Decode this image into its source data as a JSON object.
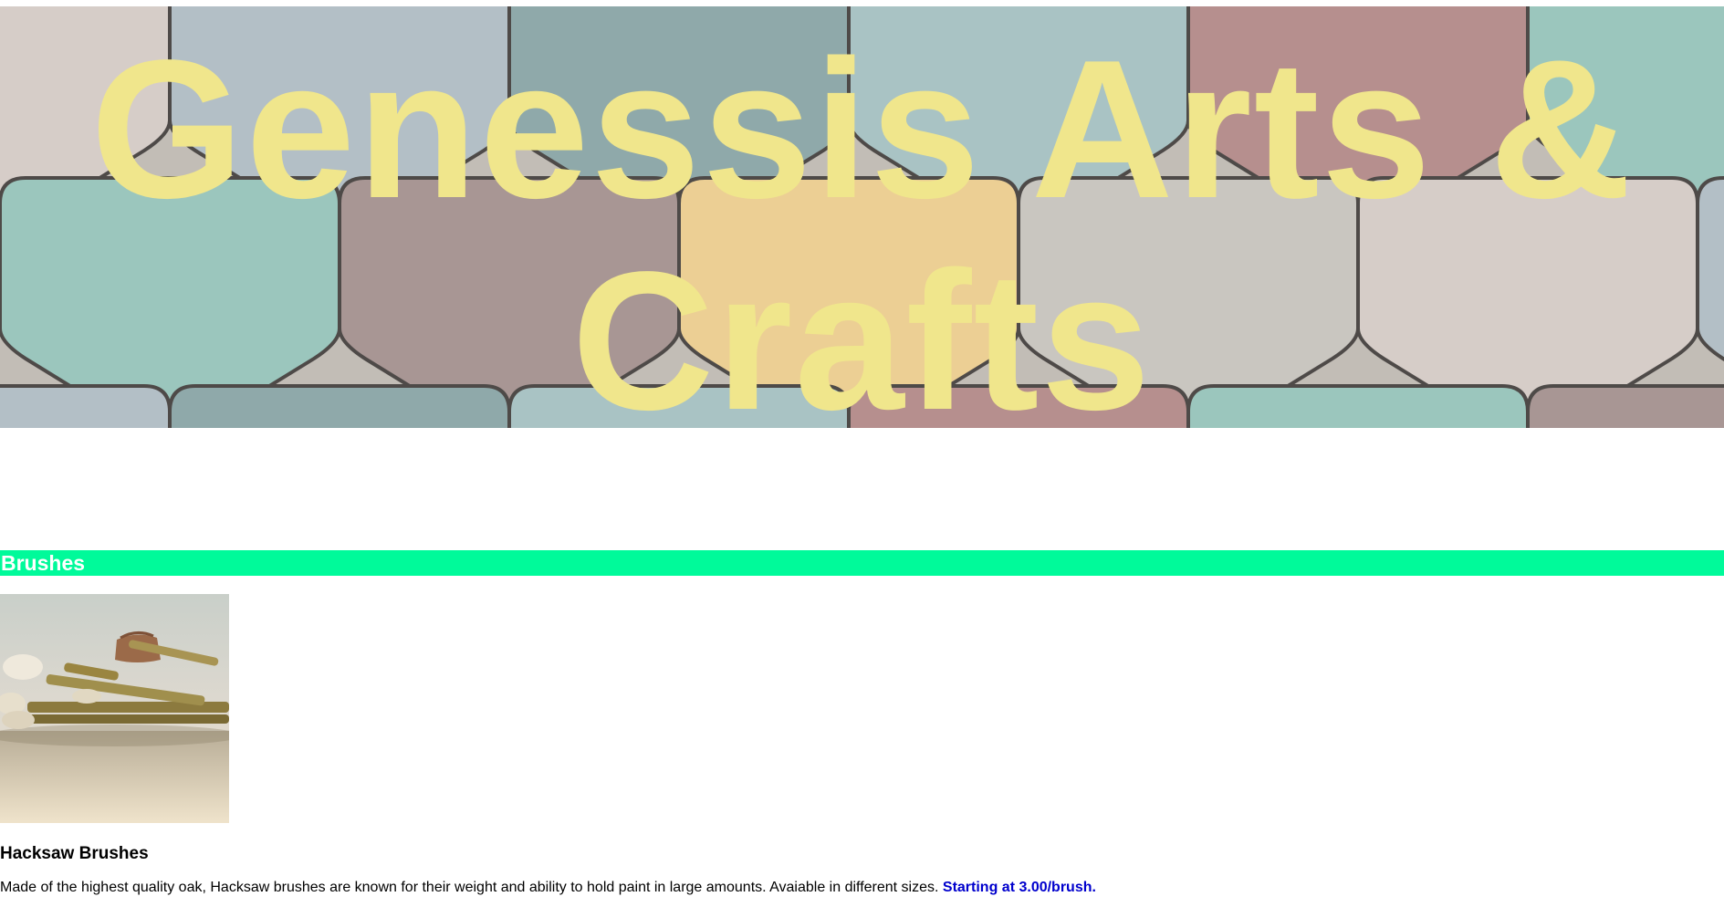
{
  "colors": {
    "title": "#f0e68c",
    "section_bar": "#00fa9a",
    "section_text": "#ffffff",
    "price": "#0000cd",
    "tiles": [
      "#b68f8e",
      "#a89694",
      "#c9c6c0",
      "#b3bfc6",
      "#a9c3c4",
      "#9bc6bd",
      "#eccf94",
      "#d6cdc8",
      "#8fa9aa"
    ]
  },
  "hero": {
    "background_image": "colored-stone-tiles",
    "title": "Genessis Arts & Crafts"
  },
  "section": {
    "heading": "Brushes"
  },
  "product": {
    "image": "paint-brushes-photo",
    "name": "Hacksaw Brushes",
    "description": "Made of the highest quality oak, Hacksaw brushes are known for their weight and ability to hold paint in large amounts. Avaiable in different sizes.",
    "price": "Starting at 3.00/brush."
  }
}
